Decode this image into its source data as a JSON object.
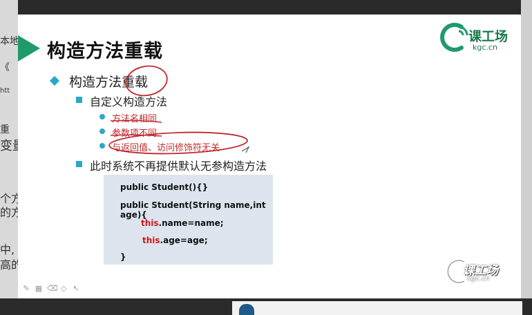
{
  "background": {
    "left_fragments": [
      "本地",
      "《",
      "htt",
      "重",
      "变量",
      "个方",
      "的方",
      "中,",
      "高的"
    ]
  },
  "slide": {
    "title": "构造方法重载",
    "logo": {
      "brand": "课工场",
      "domain": "kgc.cn"
    },
    "level1": "构造方法重载",
    "bullets": [
      {
        "text": "自定义构造方法",
        "items": [
          "方法名相同",
          "参数项不同",
          "与返回值、访问修饰符无关"
        ]
      },
      {
        "text": "此时系统不再提供默认无参构造方法",
        "items": []
      }
    ],
    "code": {
      "line1": "public Student(){}",
      "line2": "public Student(String name,int age){",
      "line3_kw": "this",
      "line3_rest": ".name=name;",
      "line4_kw": "this",
      "line4_rest": ".age=age;",
      "line5": "}"
    },
    "watermark": {
      "brand": "课工场",
      "domain": "kgc.cn"
    }
  },
  "toolbar": {
    "icons": [
      "pen-icon",
      "grid-icon",
      "eraser-icon",
      "shape-icon",
      "pointer-icon"
    ]
  },
  "colors": {
    "accent_green": "#1f9a6b",
    "bullet_blue": "#2ba7c8",
    "annotation_red": "#c0282d",
    "code_bg": "#dde4ee"
  }
}
